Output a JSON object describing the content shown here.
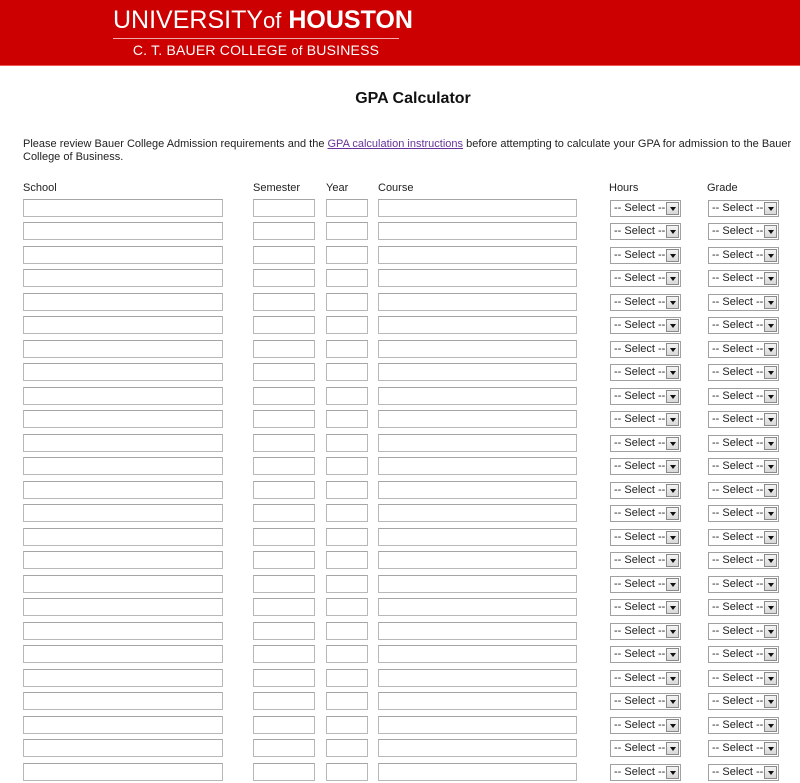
{
  "header": {
    "logo_line1_part1": "UNIVERSITY",
    "logo_line1_of": "of",
    "logo_line1_part2": "HOUSTON",
    "logo_line2_part1": "C. T. BAUER COLLEGE ",
    "logo_line2_of": "of",
    "logo_line2_part2": " BUSINESS",
    "brand_color": "#cc0000"
  },
  "page": {
    "title": "GPA Calculator",
    "intro_before": "Please review Bauer College Admission requirements and the ",
    "intro_link": "GPA calculation instructions",
    "intro_after": " before attempting to calculate your GPA for admission to the Bauer College of Business."
  },
  "columns": {
    "school": "School",
    "semester": "Semester",
    "year": "Year",
    "course": "Course",
    "hours": "Hours",
    "grade": "Grade"
  },
  "rows": {
    "count": 25,
    "school_value": "",
    "semester_value": "",
    "year_value": "",
    "course_value": "",
    "hours_selected": "-- Select --",
    "grade_selected": "-- Select --"
  }
}
